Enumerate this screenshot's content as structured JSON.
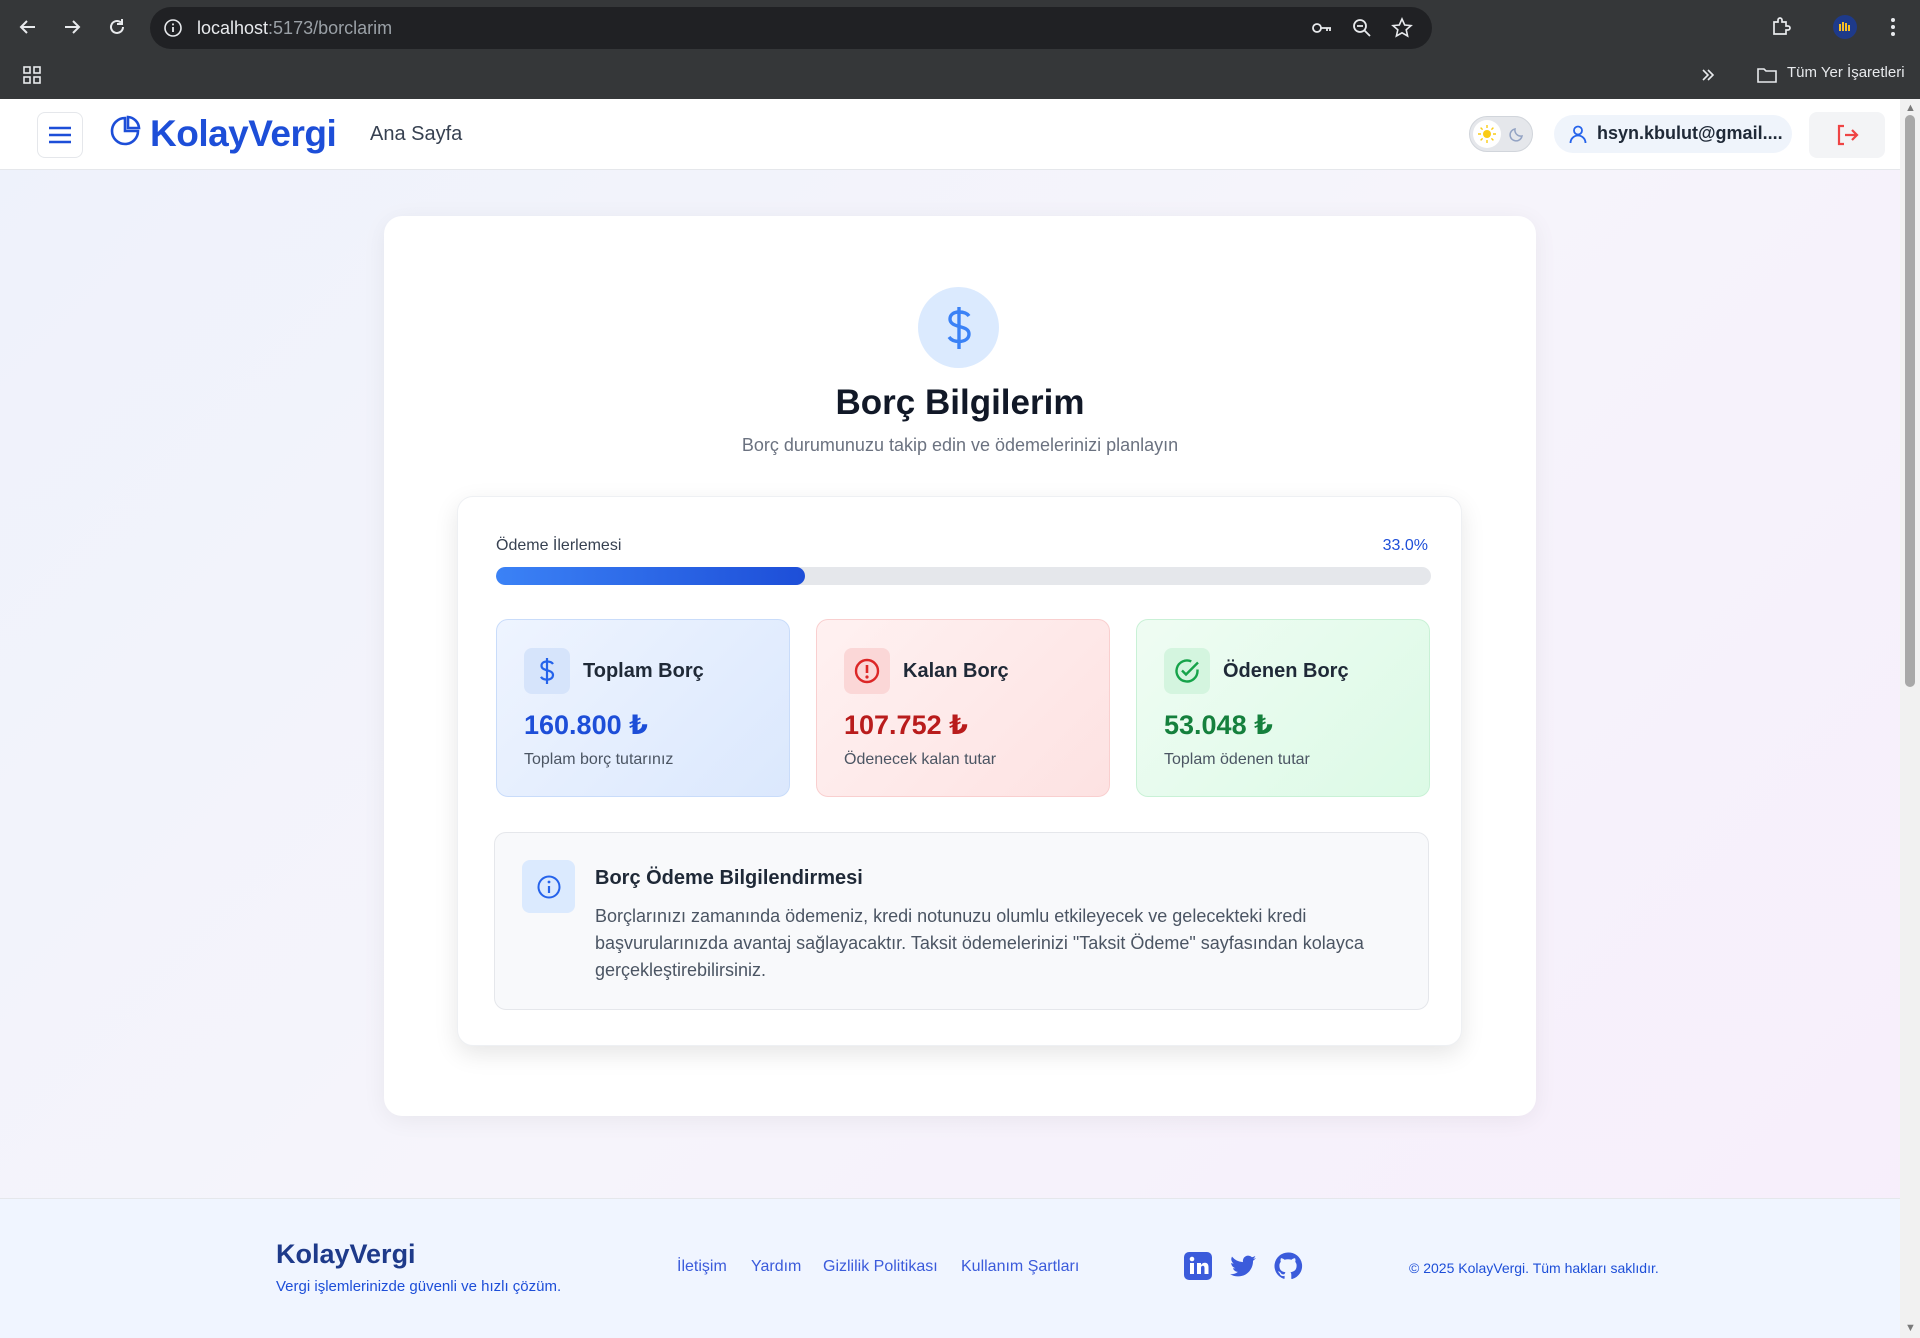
{
  "browser": {
    "url_host": "localhost",
    "url_path": ":5173/borclarim",
    "bookmarks_label": "Tüm Yer İşaretleri"
  },
  "header": {
    "logo": "KolayVergi",
    "nav_home": "Ana Sayfa",
    "user_email": "hsyn.kbulut@gmail...."
  },
  "page": {
    "title": "Borç Bilgilerim",
    "subtitle": "Borç durumunuzu takip edin ve ödemelerinizi planlayın"
  },
  "progress": {
    "label": "Ödeme İlerlemesi",
    "value_text": "33.0%",
    "fraction": 0.33
  },
  "stats": [
    {
      "title": "Toplam Borç",
      "value": "160.800 ₺",
      "desc": "Toplam borç tutarınız",
      "icon": "dollar-icon"
    },
    {
      "title": "Kalan Borç",
      "value": "107.752 ₺",
      "desc": "Ödenecek kalan tutar",
      "icon": "alert-circle-icon"
    },
    {
      "title": "Ödenen Borç",
      "value": "53.048 ₺",
      "desc": "Toplam ödenen tutar",
      "icon": "check-circle-icon"
    }
  ],
  "info": {
    "title": "Borç Ödeme Bilgilendirmesi",
    "text": "Borçlarınızı zamanında ödemeniz, kredi notunuzu olumlu etkileyecek ve gelecekteki kredi başvurularınızda avantaj sağlayacaktır. Taksit ödemelerinizi \"Taksit Ödeme\" sayfasından kolayca gerçekleştirebilirsiniz."
  },
  "footer": {
    "brand": "KolayVergi",
    "tagline": "Vergi işlemlerinizde güvenli ve hızlı çözüm.",
    "links": [
      "İletişim",
      "Yardım",
      "Gizlilik Politikası",
      "Kullanım Şartları"
    ],
    "copyright": "© 2025 KolayVergi. Tüm hakları saklıdır."
  },
  "colors": {
    "brand": "#1d4ed8",
    "debt_total": "#1d4ed8",
    "debt_remaining": "#b91c1c",
    "debt_paid": "#15803d"
  }
}
